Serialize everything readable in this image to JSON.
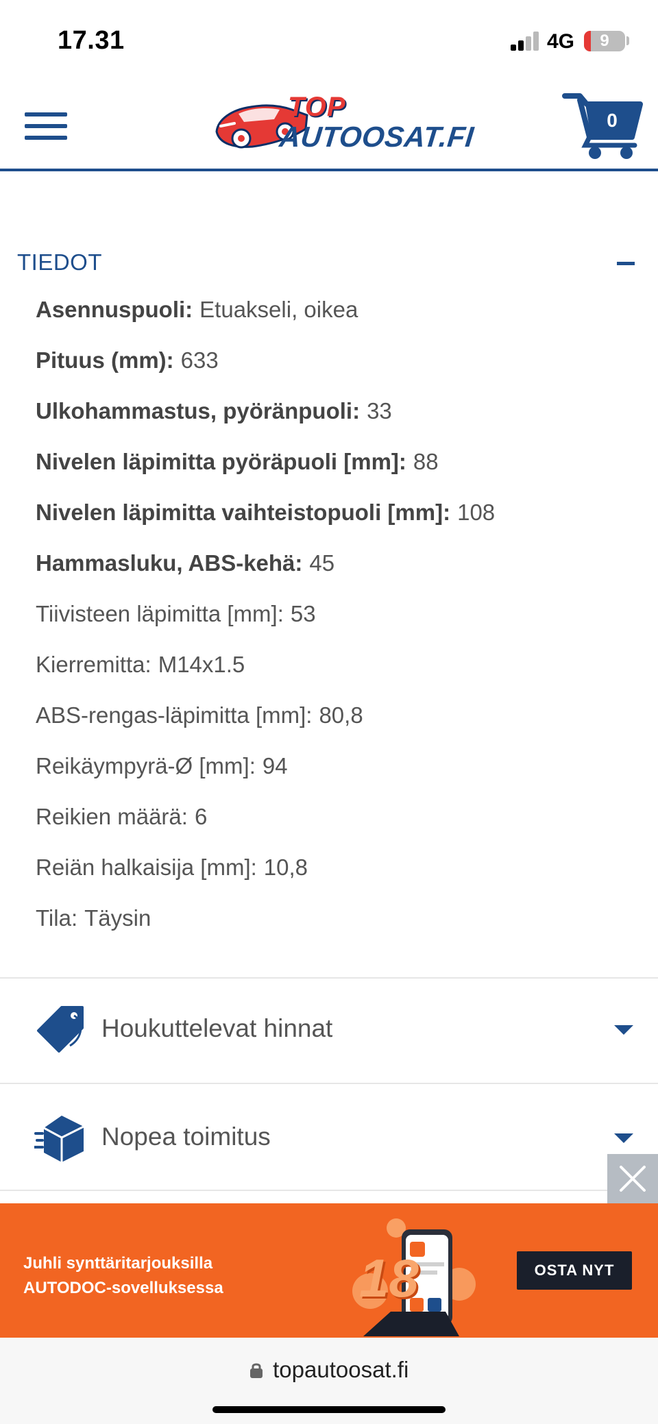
{
  "status_bar": {
    "time": "17.31",
    "network": "4G",
    "battery": "9"
  },
  "header": {
    "logo_top": "TOP",
    "logo_bottom": "AUTOOSAT.FI",
    "cart_count": "0"
  },
  "details": {
    "title": "TIEDOT",
    "specs": [
      {
        "label": "Asennuspuoli:",
        "value": "Etuakseli, oikea",
        "bold": true
      },
      {
        "label": "Pituus (mm):",
        "value": "633",
        "bold": true
      },
      {
        "label": "Ulkohammastus, pyöränpuoli:",
        "value": "33",
        "bold": true
      },
      {
        "label": "Nivelen läpimitta pyöräpuoli [mm]:",
        "value": "88",
        "bold": true
      },
      {
        "label": "Nivelen läpimitta vaihteistopuoli [mm]:",
        "value": "108",
        "bold": true
      },
      {
        "label": "Hammasluku, ABS-kehä:",
        "value": "45",
        "bold": true
      },
      {
        "label": "Tiivisteen läpimitta [mm]:",
        "value": "53",
        "bold": false
      },
      {
        "label": "Kierremitta:",
        "value": "M14x1.5",
        "bold": false
      },
      {
        "label": "ABS-rengas-läpimitta [mm]:",
        "value": "80,8",
        "bold": false
      },
      {
        "label": "Reikäympyrä-Ø [mm]:",
        "value": "94",
        "bold": false
      },
      {
        "label": "Reikien määrä:",
        "value": "6",
        "bold": false
      },
      {
        "label": "Reiän halkaisija [mm]:",
        "value": "10,8",
        "bold": false
      },
      {
        "label": "Tila:",
        "value": "Täysin",
        "bold": false
      }
    ]
  },
  "accordion": {
    "prices_label": "Houkuttelevat hinnat",
    "delivery_label": "Nopea toimitus"
  },
  "ad": {
    "line1": "Juhli synttäritarjouksilla",
    "line2": "AUTODOC-sovelluksessa",
    "cta": "OSTA NYT",
    "badge_number": "18"
  },
  "browser": {
    "url": "topautoosat.fi"
  },
  "colors": {
    "brand_blue": "#1e4e8c",
    "brand_red": "#e53935",
    "ad_orange": "#f26522"
  }
}
